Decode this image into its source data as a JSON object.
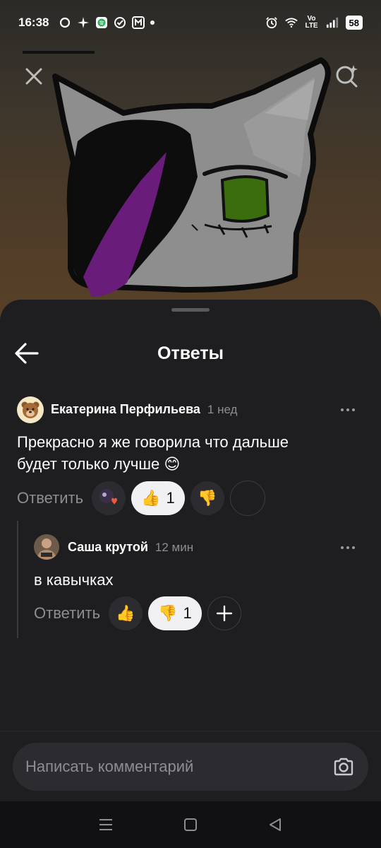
{
  "status_bar": {
    "time": "16:38",
    "battery": "58",
    "network": "Vo LTE",
    "icons": [
      "chat-bubble-icon",
      "sparkle-icon",
      "spotify-icon",
      "check-circle-icon",
      "m-badge-icon",
      "dot-icon",
      "alarm-icon",
      "wifi-icon",
      "signal-icon",
      "battery-icon"
    ]
  },
  "header": {
    "title": "Ответы",
    "back_icon": "arrow-left-icon",
    "close_icon": "close-icon",
    "lens_icon": "search-sparkle-icon"
  },
  "comments": [
    {
      "author": "Екатерина Перфильева",
      "time_ago": "1 нед",
      "text": "Прекрасно я же говорила что дальше будет только лучше 😊",
      "reply_label": "Ответить",
      "reactions": [
        {
          "type": "reactors-avatar",
          "icon": "heart-avatar-icon"
        },
        {
          "type": "like",
          "emoji": "👍",
          "count": "1",
          "active": true
        },
        {
          "type": "dislike",
          "emoji": "👎",
          "count": "",
          "active": false
        },
        {
          "type": "empty",
          "emoji": "",
          "count": "",
          "active": false
        }
      ]
    },
    {
      "author": "Саша крутой",
      "time_ago": "12 мин",
      "text": "в кавычках",
      "reply_label": "Ответить",
      "reactions": [
        {
          "type": "like",
          "emoji": "👍",
          "count": "",
          "active": false
        },
        {
          "type": "dislike",
          "emoji": "👎",
          "count": "1",
          "active": true
        },
        {
          "type": "add",
          "emoji": "+",
          "count": "",
          "active": false
        }
      ]
    }
  ],
  "composer": {
    "placeholder": "Написать комментарий",
    "camera_icon": "camera-icon"
  },
  "navbar": {
    "icons": [
      "menu-icon",
      "home-square-icon",
      "back-triangle-icon"
    ]
  },
  "colors": {
    "sheet_bg": "#1e1e21",
    "pill_bg": "#2c2c30",
    "muted_text": "#8d8d92",
    "active_pill": "#f1f1f3"
  }
}
